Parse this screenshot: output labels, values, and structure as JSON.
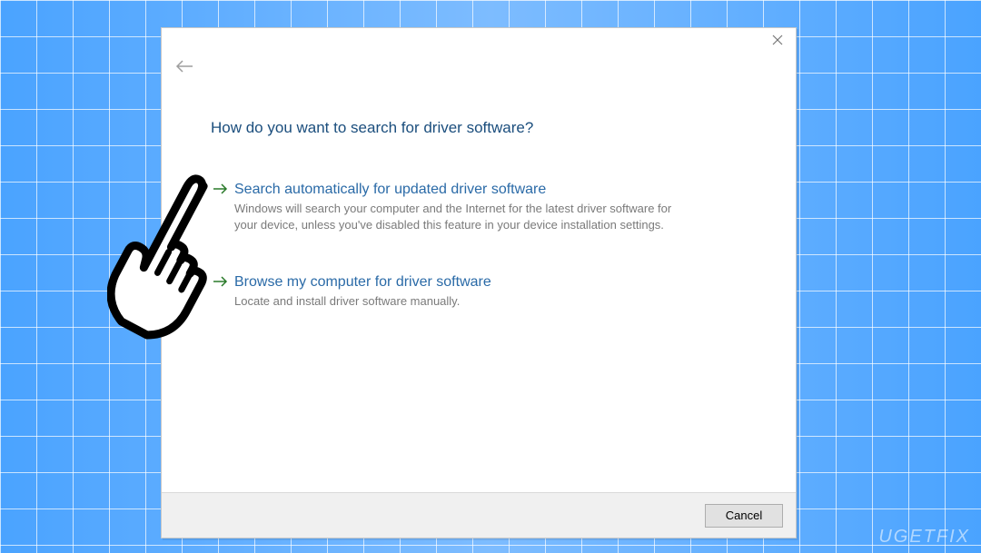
{
  "dialog": {
    "heading": "How do you want to search for driver software?",
    "options": [
      {
        "title": "Search automatically for updated driver software",
        "description": "Windows will search your computer and the Internet for the latest driver software for your device, unless you've disabled this feature in your device installation settings."
      },
      {
        "title": "Browse my computer for driver software",
        "description": "Locate and install driver software manually."
      }
    ],
    "cancel_label": "Cancel"
  },
  "watermark": "UGETFIX"
}
